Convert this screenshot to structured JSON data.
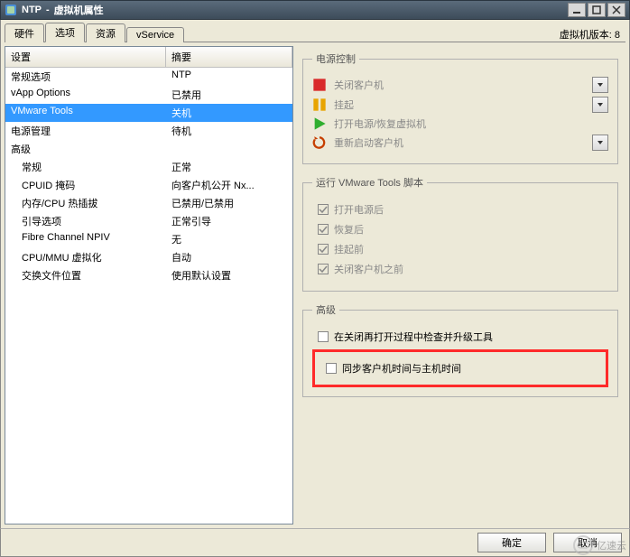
{
  "title": {
    "app": "NTP",
    "sep": "-",
    "suffix": "虚拟机属性"
  },
  "vm_version_label": "虚拟机版本: 8",
  "tabs": [
    "硬件",
    "选项",
    "资源",
    "vService"
  ],
  "active_tab_index": 1,
  "list": {
    "columns": [
      "设置",
      "摘要"
    ],
    "groups": [
      {
        "label": "常规选项",
        "summary": "NTP",
        "children": []
      },
      {
        "label": "vApp Options",
        "summary": "已禁用",
        "children": []
      },
      {
        "label": "VMware Tools",
        "summary": "关机",
        "selected": true,
        "children": []
      },
      {
        "label": "电源管理",
        "summary": "待机",
        "children": []
      },
      {
        "label": "高级",
        "summary": "",
        "children": [
          {
            "label": "常规",
            "summary": "正常"
          },
          {
            "label": "CPUID 掩码",
            "summary": "向客户机公开 Nx..."
          },
          {
            "label": "内存/CPU 热插拔",
            "summary": "已禁用/已禁用"
          },
          {
            "label": "引导选项",
            "summary": "正常引导"
          },
          {
            "label": "Fibre Channel NPIV",
            "summary": "无"
          },
          {
            "label": "CPU/MMU 虚拟化",
            "summary": "自动"
          },
          {
            "label": "交换文件位置",
            "summary": "使用默认设置"
          }
        ]
      }
    ]
  },
  "power_control": {
    "legend": "电源控制",
    "rows": [
      {
        "icon": "stop",
        "color": "#d92a2a",
        "label": "关闭客户机",
        "combo": true
      },
      {
        "icon": "pause",
        "color": "#e8a400",
        "label": "挂起",
        "combo": true
      },
      {
        "icon": "play",
        "color": "#2fae2f",
        "label": "打开电源/恢复虚拟机",
        "combo": false
      },
      {
        "icon": "restart",
        "color": "#c63f00",
        "label": "重新启动客户机",
        "combo": true
      }
    ]
  },
  "scripts": {
    "legend": "运行 VMware Tools 脚本",
    "items": [
      {
        "label": "打开电源后",
        "checked": true
      },
      {
        "label": "恢复后",
        "checked": true
      },
      {
        "label": "挂起前",
        "checked": true
      },
      {
        "label": "关闭客户机之前",
        "checked": true
      }
    ]
  },
  "advanced": {
    "legend": "高级",
    "items": [
      {
        "label": "在关闭再打开过程中检查并升级工具",
        "checked": false,
        "highlighted": false
      },
      {
        "label": "同步客户机时间与主机时间",
        "checked": false,
        "highlighted": true
      }
    ]
  },
  "buttons": {
    "ok": "确定",
    "cancel": "取消"
  },
  "watermark": "亿速云"
}
